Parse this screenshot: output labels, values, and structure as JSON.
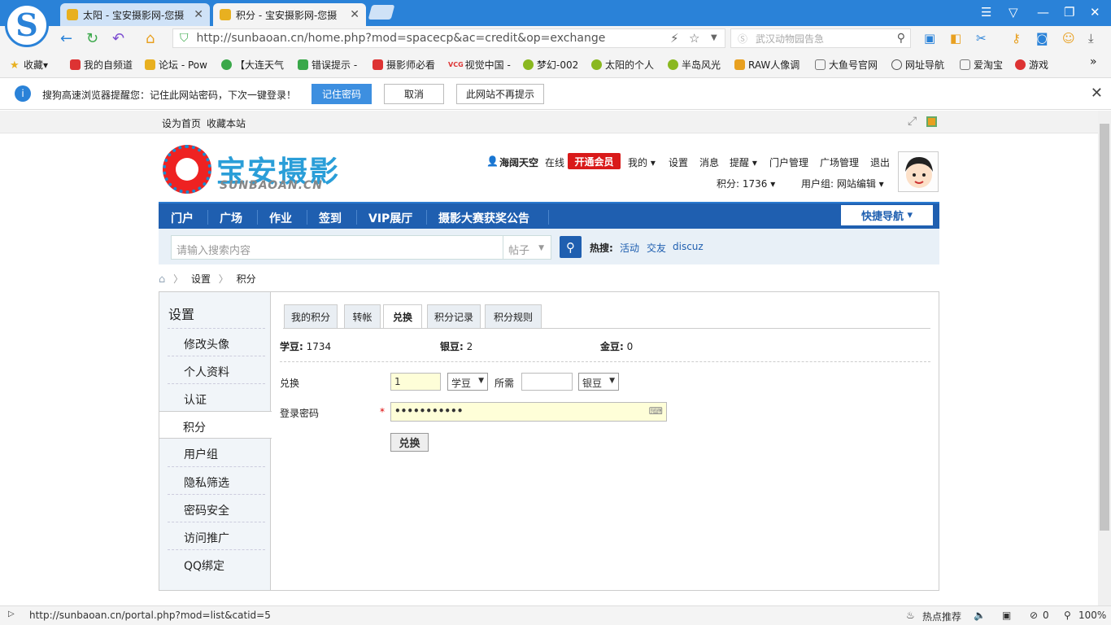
{
  "browser": {
    "tabs": [
      {
        "title": "太阳 - 宝安摄影网-您摄"
      },
      {
        "title": "积分 - 宝安摄影网-您摄"
      }
    ],
    "url": "http://sunbaoan.cn/home.php?mod=spacecp&ac=credit&op=exchange",
    "search_placeholder": "武汉动物园告急",
    "bookmarks": [
      "收藏",
      "我的自频道",
      "论坛 - Pow",
      "【大连天气",
      "错误提示 -",
      "摄影师必看",
      "视觉中国 -",
      "梦幻-002",
      "太阳的个人",
      "半岛风光",
      "RAW人像调",
      "大鱼号官网",
      "网址导航",
      "爱淘宝",
      "游戏"
    ],
    "vcg_label": "VCG",
    "password_prompt": {
      "message": "搜狗高速浏览器提醒您：记住此网站密码，下次一键登录！",
      "remember": "记住密码",
      "cancel": "取消",
      "never": "此网站不再提示"
    },
    "status_url": "http://sunbaoan.cn/portal.php?mod=list&catid=5",
    "status_hot": "热点推荐",
    "status_count": "0",
    "zoom": "100%"
  },
  "site": {
    "top_links": [
      "设为首页",
      "收藏本站"
    ],
    "name": "宝安摄影",
    "domain_text": "SUNBAOAN.CN",
    "user": {
      "name": "海阔天空",
      "online": "在线",
      "vip": "开通会员",
      "links": [
        "我的",
        "设置",
        "消息",
        "提醒",
        "门户管理",
        "广场管理",
        "退出"
      ],
      "credits": "积分: 1736",
      "group": "用户组: 网站编辑"
    },
    "nav": [
      "门户",
      "广场",
      "作业",
      "签到",
      "VIP展厅",
      "摄影大赛获奖公告"
    ],
    "quick_nav": "快捷导航",
    "search": {
      "placeholder": "请输入搜索内容",
      "type": "帖子",
      "hot_label": "热搜:",
      "hot": [
        "活动",
        "交友",
        "discuz"
      ]
    },
    "breadcrumb": [
      "设置",
      "积分"
    ]
  },
  "settings": {
    "title": "设置",
    "menu": [
      "修改头像",
      "个人资料",
      "认证",
      "积分",
      "用户组",
      "隐私筛选",
      "密码安全",
      "访问推广",
      "QQ绑定"
    ],
    "tabs": [
      "我的积分",
      "转帐",
      "兑换",
      "积分记录",
      "积分规则"
    ],
    "beans": [
      {
        "label": "学豆:",
        "value": "1734"
      },
      {
        "label": "银豆:",
        "value": "2"
      },
      {
        "label": "金豆:",
        "value": "0"
      }
    ],
    "form": {
      "exchange_label": "兑换",
      "amount": "1",
      "from_unit": "学豆",
      "need_label": "所需",
      "need_value": "",
      "to_unit": "银豆",
      "password_label": "登录密码",
      "required_mark": "*",
      "password_value": "•••••••••••",
      "submit": "兑换"
    }
  }
}
